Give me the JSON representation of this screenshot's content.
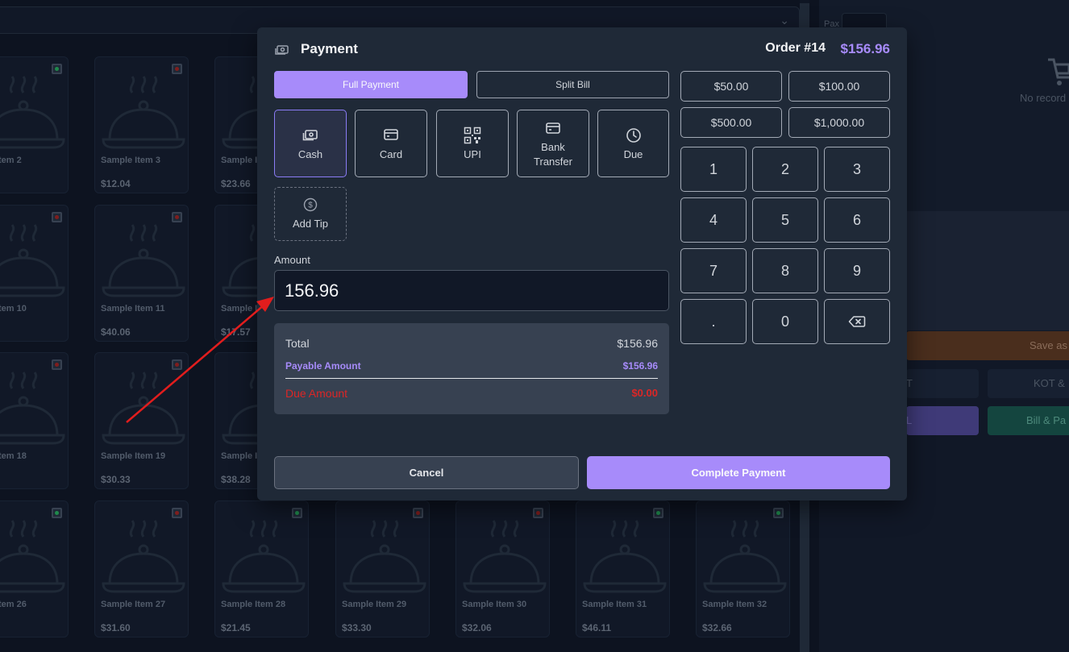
{
  "background": {
    "pax_label": "Pax",
    "no_records_text": "No record",
    "save_label": "Save as",
    "kot_label": "T",
    "kot2_label": "KOT &",
    "purple_label": "L",
    "bill_label": "Bill & Pa",
    "items": [
      {
        "name": "ple Item 2",
        "price": "45",
        "veg": true
      },
      {
        "name": "Sample Item 3",
        "price": "$12.04",
        "veg": false
      },
      {
        "name": "Sample It",
        "price": "$23.66",
        "veg": false
      },
      {
        "name": "ple Item 10",
        "price": "06",
        "veg": false
      },
      {
        "name": "Sample Item 11",
        "price": "$40.06",
        "veg": false
      },
      {
        "name": "Sample It",
        "price": "$17.57",
        "veg": false
      },
      {
        "name": "ple Item 18",
        "price": "56",
        "veg": false
      },
      {
        "name": "Sample Item 19",
        "price": "$30.33",
        "veg": false
      },
      {
        "name": "Sample It",
        "price": "$38.28",
        "veg": false
      },
      {
        "name": "ple Item 26",
        "price": "38",
        "veg": true
      },
      {
        "name": "Sample Item 27",
        "price": "$31.60",
        "veg": false
      },
      {
        "name": "Sample Item 28",
        "price": "$21.45",
        "veg": true
      },
      {
        "name": "Sample Item 29",
        "price": "$33.30",
        "veg": false
      },
      {
        "name": "Sample Item 30",
        "price": "$32.06",
        "veg": false
      },
      {
        "name": "Sample Item 31",
        "price": "$46.11",
        "veg": true
      },
      {
        "name": "Sample Item 32",
        "price": "$32.66",
        "veg": true
      }
    ]
  },
  "modal": {
    "title": "Payment",
    "order_label": "Order #14",
    "order_total": "$156.96",
    "tabs": {
      "full": "Full Payment",
      "split": "Split Bill"
    },
    "methods": [
      {
        "label": "Cash",
        "icon": "cash-icon"
      },
      {
        "label": "Card",
        "icon": "card-icon"
      },
      {
        "label": "UPI",
        "icon": "qr-code-icon"
      },
      {
        "label_line1": "Bank",
        "label_line2": "Transfer",
        "icon": "bank-card-icon"
      },
      {
        "label": "Due",
        "icon": "clock-icon"
      }
    ],
    "tip_label": "Add Tip",
    "amount_label": "Amount",
    "amount_value": "156.96",
    "summary": {
      "total_label": "Total",
      "total_value": "$156.96",
      "payable_label": "Payable Amount",
      "payable_value": "$156.96",
      "due_label": "Due Amount",
      "due_value": "$0.00"
    },
    "quick_amounts": [
      "$50.00",
      "$100.00",
      "$500.00",
      "$1,000.00"
    ],
    "keypad": [
      "1",
      "2",
      "3",
      "4",
      "5",
      "6",
      "7",
      "8",
      "9",
      ".",
      "0"
    ],
    "cancel_label": "Cancel",
    "complete_label": "Complete Payment"
  },
  "colors": {
    "accent": "#a78bfa",
    "modal_bg": "#1f2937",
    "due": "#dc2626",
    "annotation_arrow": "#e11d1d"
  }
}
